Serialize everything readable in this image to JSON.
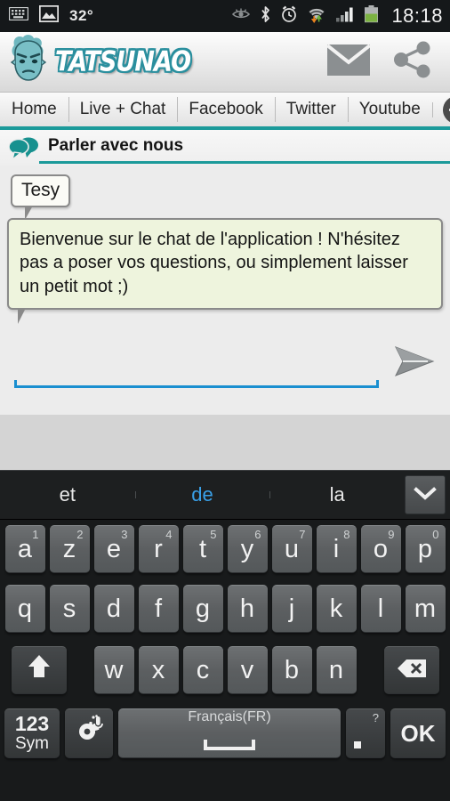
{
  "status_bar": {
    "keyboard_icon": "keyboard-icon",
    "screenshot_icon": "image-icon",
    "temperature": "32°",
    "right_icons": [
      "eye-icon",
      "bluetooth-icon",
      "alarm-icon",
      "wifi-icon",
      "signal-icon",
      "battery-icon"
    ],
    "time": "18:18"
  },
  "app_bar": {
    "logo_text": "TATSUNAO",
    "mail_label": "mail-icon",
    "share_label": "share-icon"
  },
  "tabs": [
    {
      "label": "Home"
    },
    {
      "label": "Live + Chat"
    },
    {
      "label": "Facebook"
    },
    {
      "label": "Twitter"
    },
    {
      "label": "Youtube"
    }
  ],
  "tab_add_label": "+",
  "chat": {
    "section_title": "Parler avec nous",
    "sender_name": "Tesy",
    "message": "Bienvenue sur le chat de l'application ! N'hésitez pas a poser vos questions, ou simplement laisser un petit mot ;)",
    "input_value": "",
    "input_placeholder": "",
    "send_label": "send-icon"
  },
  "keyboard": {
    "suggestions": [
      {
        "word": "et",
        "active": false
      },
      {
        "word": "de",
        "active": true
      },
      {
        "word": "la",
        "active": false
      }
    ],
    "expand_label": "chevron-down-icon",
    "row1": [
      {
        "key": "a",
        "hint": "1"
      },
      {
        "key": "z",
        "hint": "2"
      },
      {
        "key": "e",
        "hint": "3"
      },
      {
        "key": "r",
        "hint": "4"
      },
      {
        "key": "t",
        "hint": "5"
      },
      {
        "key": "y",
        "hint": "6"
      },
      {
        "key": "u",
        "hint": "7"
      },
      {
        "key": "i",
        "hint": "8"
      },
      {
        "key": "o",
        "hint": "9"
      },
      {
        "key": "p",
        "hint": "0"
      }
    ],
    "row2": [
      {
        "key": "q"
      },
      {
        "key": "s"
      },
      {
        "key": "d"
      },
      {
        "key": "f"
      },
      {
        "key": "g"
      },
      {
        "key": "h"
      },
      {
        "key": "j"
      },
      {
        "key": "k"
      },
      {
        "key": "l"
      },
      {
        "key": "m"
      }
    ],
    "row3": [
      {
        "key": "w"
      },
      {
        "key": "x"
      },
      {
        "key": "c"
      },
      {
        "key": "v"
      },
      {
        "key": "b"
      },
      {
        "key": "n"
      }
    ],
    "shift_label": "shift-icon",
    "backspace_label": "backspace-icon",
    "sym_line1": "123",
    "sym_line2": "Sym",
    "settings_label": "gear-icon",
    "space_label": "Français(FR)",
    "period_key": ".",
    "period_hint": "?",
    "ok_label": "OK"
  },
  "colors": {
    "accent_teal": "#1b9a9a",
    "input_blue": "#1a8fd0",
    "suggestion_blue": "#39a0e8",
    "bubble_green": "#eef4dd",
    "status_bg": "#15181a"
  }
}
